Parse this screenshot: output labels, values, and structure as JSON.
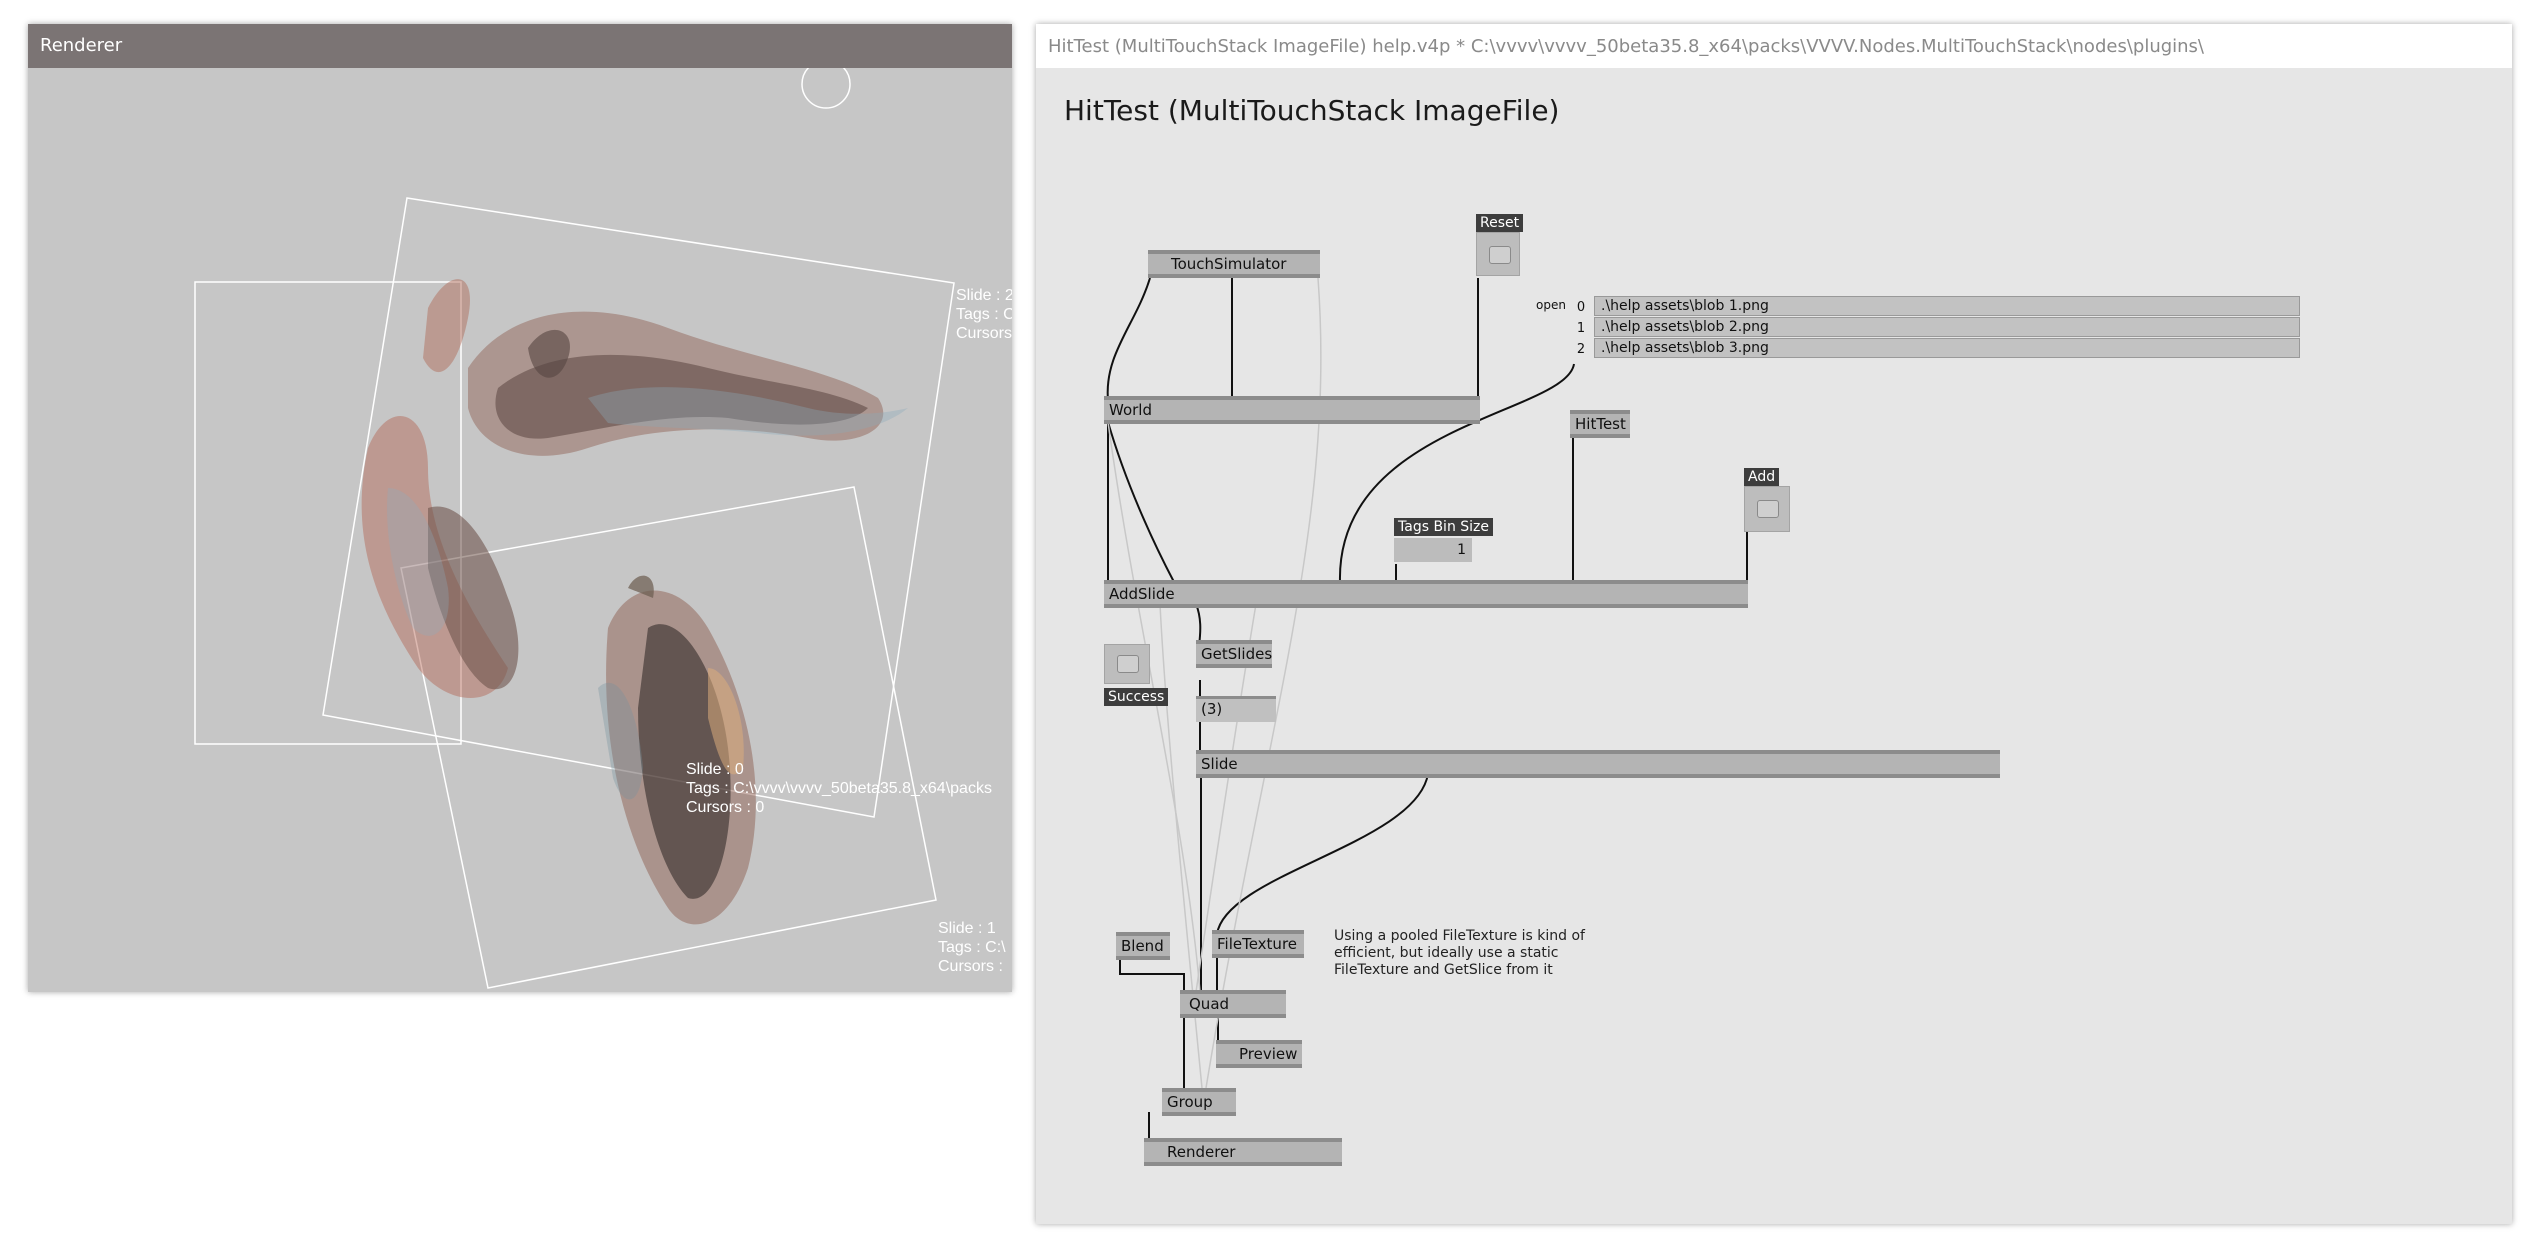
{
  "renderer": {
    "title": "Renderer",
    "slides": [
      {
        "name": "Slide : 2",
        "tags": "Tags : C",
        "cursors": "Cursors"
      },
      {
        "name": "Slide : 0",
        "tags": "Tags : C:\\vvvv\\vvvv_50beta35.8_x64\\packs",
        "cursors": "Cursors : 0"
      },
      {
        "name": "Slide : 1",
        "tags": "Tags : C:\\",
        "cursors": "Cursors :"
      }
    ]
  },
  "patch": {
    "window_title": "HitTest (MultiTouchStack ImageFile) help.v4p *   C:\\vvvv\\vvvv_50beta35.8_x64\\packs\\VVVV.Nodes.MultiTouchStack\\nodes\\plugins\\",
    "heading": "HitTest (MultiTouchStack ImageFile)",
    "nodes": {
      "touch_simulator": "TouchSimulator",
      "world": "World",
      "hittest": "HitTest",
      "addslide": "AddSlide",
      "getslides": "GetSlides",
      "spread_count": "(3)",
      "slide": "Slide",
      "blend": "Blend",
      "filetexture": "FileTexture",
      "quad": "Quad",
      "preview": "Preview",
      "group": "Group",
      "renderer": "Renderer"
    },
    "labels": {
      "reset": "Reset",
      "add": "Add",
      "success": "Success",
      "tags_bin_size": "Tags Bin Size",
      "open": "open"
    },
    "tags_bin_size_value": "1",
    "files": [
      {
        "index": "0",
        "path": ".\\help assets\\blob 1.png"
      },
      {
        "index": "1",
        "path": ".\\help assets\\blob 2.png"
      },
      {
        "index": "2",
        "path": ".\\help assets\\blob 3.png"
      }
    ],
    "comment": [
      "Using a pooled FileTexture is kind of",
      "efficient, but ideally use a static",
      "FileTexture and GetSlice from it"
    ]
  }
}
